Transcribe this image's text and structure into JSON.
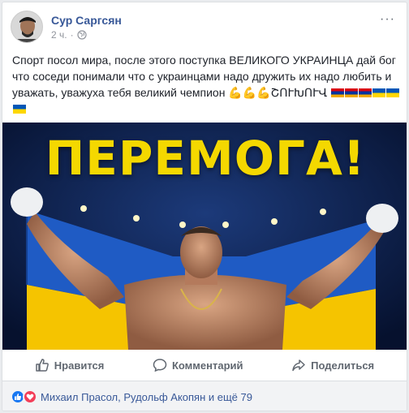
{
  "post": {
    "author": "Сур Саргсян",
    "time": "2 ч.",
    "more_label": "···",
    "text": "Спорт посол мира, после этого поступка ВЕЛИКОГО УКРАИНЦА дай бог что соседи понимали что с украинцами надо дружить их надо любить и уважать, уважуха тебя великий чемпион 💪💪💪ՇՈՒԽՈՒՎ",
    "image_headline": "ПЕРЕМОГА!"
  },
  "actions": {
    "like": "Нравится",
    "comment": "Комментарий",
    "share": "Поделиться"
  },
  "reactions": {
    "summary": "Михаил Прасол, Рудольф Акопян и ещё 79"
  },
  "colors": {
    "author_link": "#385898",
    "like_blue": "#1877f2",
    "love_red": "#f33e58",
    "headline_yellow": "#f4d800",
    "flag_blue": "#0057b7",
    "flag_yellow": "#ffd700"
  },
  "icons": {
    "globe": "globe-icon",
    "like": "thumbs-up-icon",
    "comment": "speech-bubble-icon",
    "share": "share-arrow-icon",
    "like_reaction": "like-reaction-icon",
    "love_reaction": "heart-reaction-icon"
  }
}
